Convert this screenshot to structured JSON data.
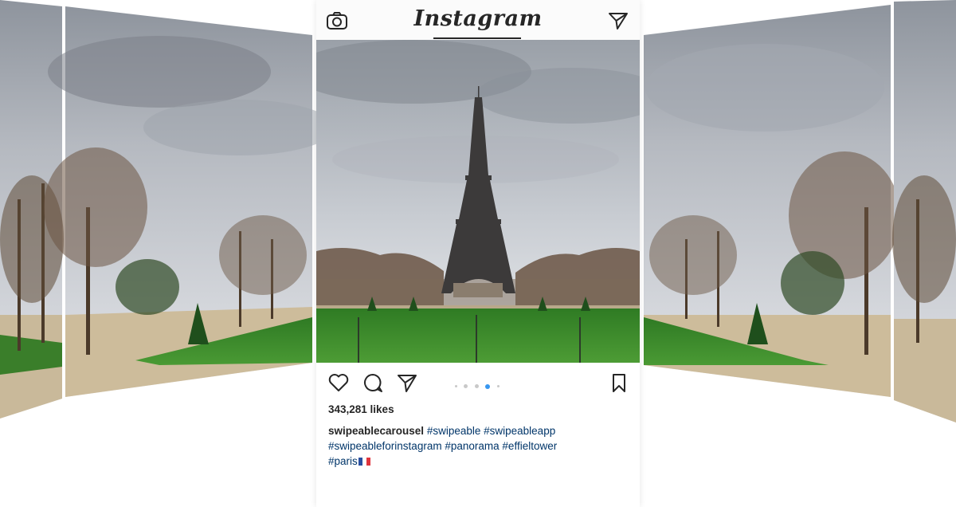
{
  "header": {
    "logo_text": "Instagram",
    "left_icon": "camera-icon",
    "right_icon": "direct-send-icon"
  },
  "post": {
    "image_description": "",
    "actions": {
      "like_icon": "heart-icon",
      "comment_icon": "comment-icon",
      "share_icon": "send-icon",
      "save_icon": "bookmark-icon"
    },
    "carousel": {
      "total_dots": 5,
      "active_index": 3
    },
    "likes": "343,281 likes",
    "caption": {
      "username": "swipeablecarousel",
      "tags": [
        "#swipeable",
        "#swipeableapp",
        "#swipeableforinstagram",
        "#panorama",
        "#effieltower",
        "#paris"
      ],
      "flag": "french-flag-emoji"
    }
  },
  "colors": {
    "hashtag": "#003569",
    "active_dot": "#3897f0",
    "grass": "#3f8a2c",
    "sky": "#c9ccd2"
  }
}
